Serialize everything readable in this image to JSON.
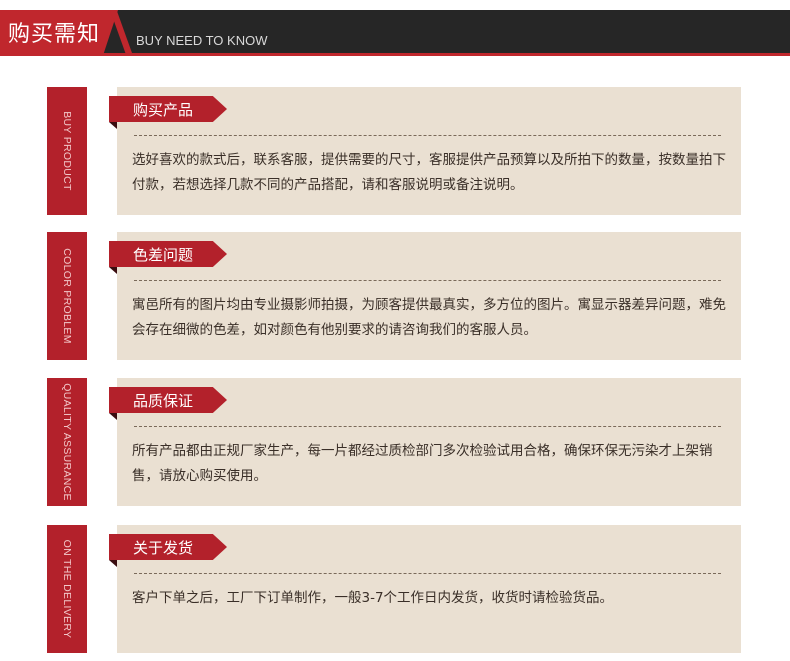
{
  "header": {
    "title": "购买需知",
    "subtitle": "BUY NEED TO KNOW"
  },
  "sections": [
    {
      "side_label": "BUY PRODUCT",
      "tag": "购买产品",
      "text": "选好喜欢的款式后，联系客服，提供需要的尺寸，客服提供产品预算以及所拍下的数量，按数量拍下付款，若想选择几款不同的产品搭配，请和客服说明或备注说明。"
    },
    {
      "side_label": "COLOR PROBLEM",
      "tag": "色差问题",
      "text": "寓邑所有的图片均由专业摄影师拍摄，为顾客提供最真实，多方位的图片。寓显示器差异问题，难免会存在细微的色差，如对颜色有他别要求的请咨询我们的客服人员。"
    },
    {
      "side_label": "QUALITY ASSURANCE",
      "tag": "品质保证",
      "text": "所有产品都由正规厂家生产，每一片都经过质检部门多次检验试用合格，确保环保无污染才上架销售，请放心购买使用。"
    },
    {
      "side_label": "ON THE DELIVERY",
      "tag": "关于发货",
      "text": "客户下单之后，工厂下订单制作，一般3-7个工作日内发货，收货时请检验货品。"
    }
  ],
  "colors": {
    "accent_red": "#b3212b",
    "header_dark": "#262626",
    "panel_beige": "#eae0d2"
  }
}
